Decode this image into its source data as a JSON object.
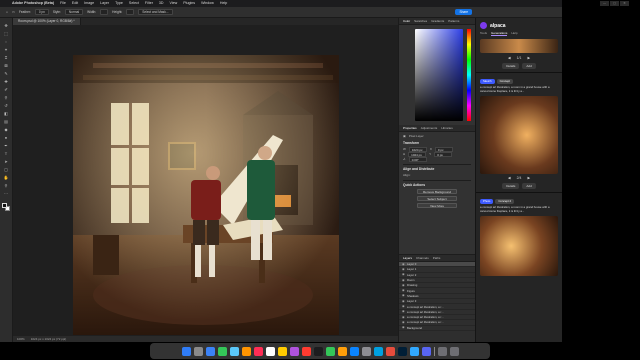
{
  "menubar": {
    "apple": "",
    "app": "Adobe Photoshop (Beta)",
    "items": [
      "File",
      "Edit",
      "Image",
      "Layer",
      "Type",
      "Select",
      "Filter",
      "3D",
      "View",
      "Plugins",
      "Window",
      "Help"
    ]
  },
  "options": {
    "feather_label": "Feather:",
    "feather_value": "0 px",
    "style_label": "Style:",
    "style_value": "Normal",
    "width_label": "Width:",
    "height_label": "Height:",
    "select_mask": "Select and Mask...",
    "share": "Share"
  },
  "document": {
    "tab_title": "Room.psd @ 100% (Layer 0, RGB/8#) *"
  },
  "status": {
    "zoom": "100%",
    "info": "1024 px x 1024 px (72 ppi)"
  },
  "panels": {
    "top_tabs": [
      "Color",
      "Swatches",
      "Gradients",
      "Patterns"
    ],
    "properties_tabs": [
      "Properties",
      "Adjustments",
      "Libraries"
    ],
    "pixel_layer": "Pixel Layer",
    "transform": "Transform",
    "w_label": "W",
    "w_value": "1024 px",
    "h_label": "H",
    "h_value": "1024 px",
    "x_label": "X",
    "x_value": "0 px",
    "y_label": "Y",
    "y_value": "0 px",
    "angle": "0.00°",
    "align": "Align and Distribute",
    "align_sub": "Align:",
    "quick_actions": "Quick Actions",
    "remove_bg": "Remove Background",
    "select_subject": "Select Subject",
    "view_more": "View More",
    "layers_tabs": [
      "Layers",
      "Channels",
      "Paths"
    ],
    "layers": [
      "Layer 0",
      "Layer 1",
      "Layer 2",
      "Room",
      "Drawing",
      "Figure",
      "Shadows",
      "Layer 3",
      "a concept art illustration, a r...",
      "a concept art illustration, a r...",
      "a concept art illustration, a r...",
      "a concept art illustration, a r...",
      "Background"
    ]
  },
  "alpaca": {
    "title": "alpaca",
    "tabs": [
      "Tools",
      "Generations",
      "Help"
    ],
    "counter_1": "1/1",
    "counter_2": "2/4",
    "details": "Details",
    "add": "Add",
    "tags_1": [
      "Sketch",
      "Concept"
    ],
    "tags_2": [
      "Photo",
      "Concept 2"
    ],
    "prompt_1": "a concept art illustration, a room in a grand house with a carved stone fireplace, it is lit by a...",
    "prompt_2": "a concept art illustration, a room in a grand house with a carved stone fireplace, it is lit by a...",
    "prompt_3": "a concept art illustration, a room in a grand house with a carved stone fireplace, it is lit by a...",
    "read_more": "...see more"
  }
}
